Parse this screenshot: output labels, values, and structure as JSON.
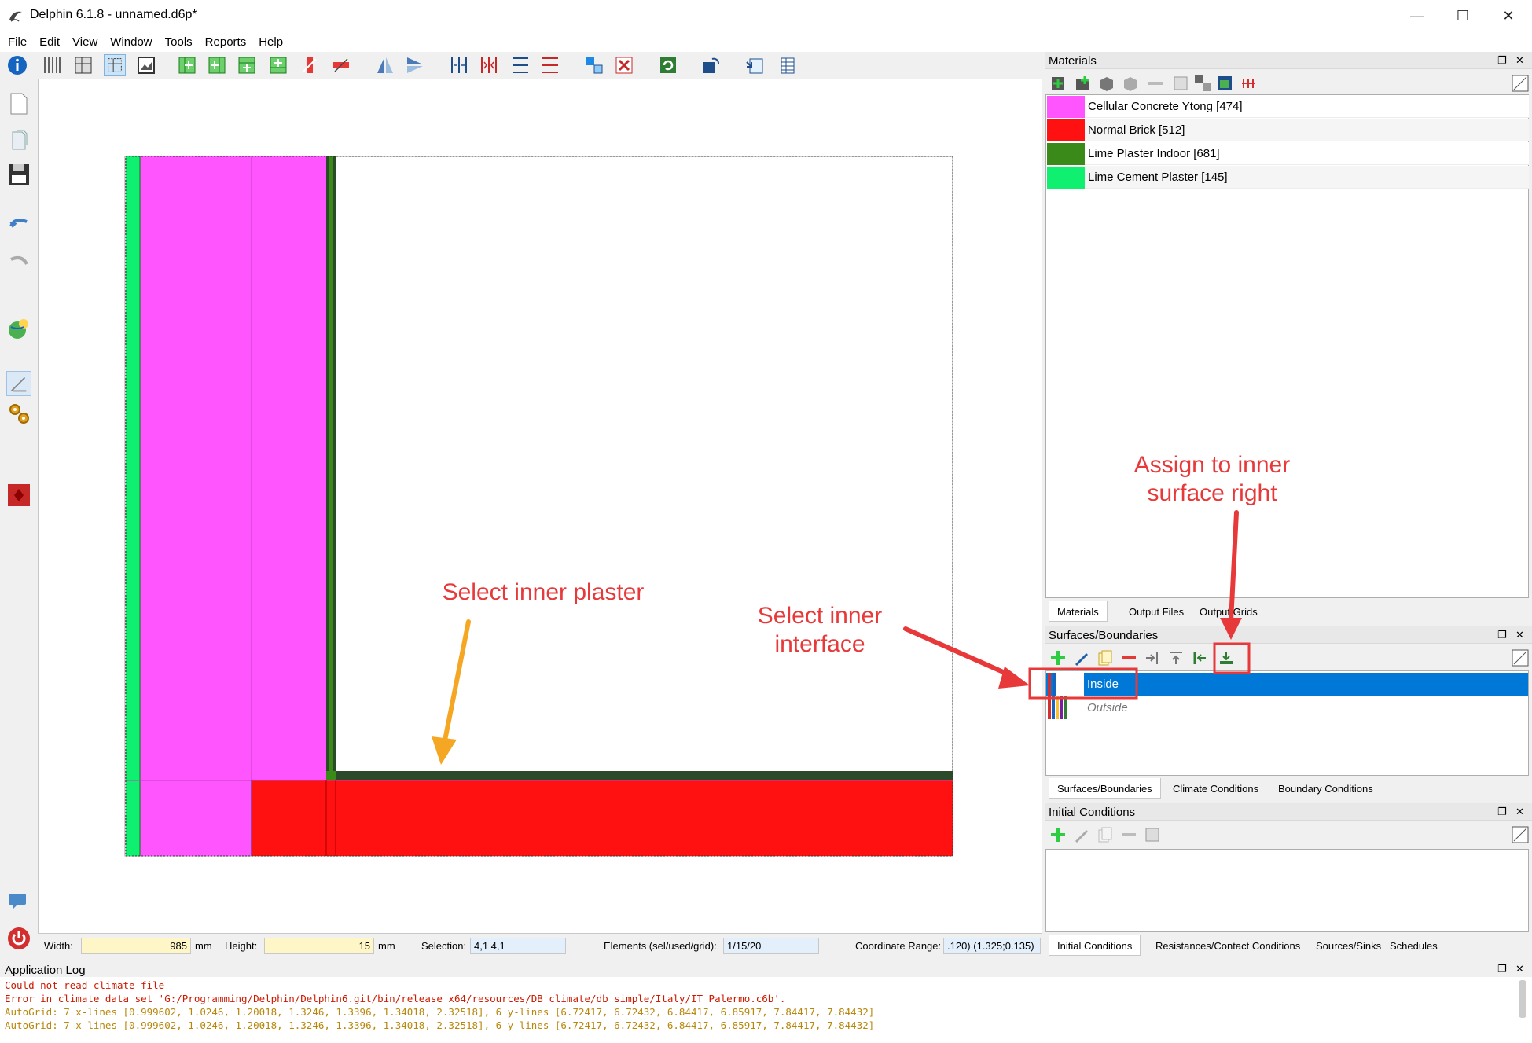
{
  "window": {
    "title": "Delphin 6.1.8 - unnamed.d6p*",
    "minimize": "—",
    "maximize": "☐",
    "close": "✕"
  },
  "menu": [
    "File",
    "Edit",
    "View",
    "Window",
    "Tools",
    "Reports",
    "Help"
  ],
  "status": {
    "width_label": "Width:",
    "width_value": "985",
    "width_unit": "mm",
    "height_label": "Height:",
    "height_value": "15",
    "height_unit": "mm",
    "selection_label": "Selection:",
    "selection_value": "4,1  4,1",
    "elements_label": "Elements (sel/used/grid):",
    "elements_value": "1/15/20",
    "coord_label": "Coordinate Range:",
    "coord_value": ".120)  (1.325;0.135)"
  },
  "materials_panel": {
    "title": "Materials",
    "items": [
      {
        "name": "Cellular Concrete Ytong [474]",
        "color": "#ff55ff"
      },
      {
        "name": "Normal Brick [512]",
        "color": "#ff1111"
      },
      {
        "name": "Lime Plaster Indoor [681]",
        "color": "#3a8a1a"
      },
      {
        "name": "Lime Cement Plaster [145]",
        "color": "#10f070"
      }
    ],
    "tabs": [
      "Materials",
      "Output Files",
      "Output Grids"
    ]
  },
  "surfaces_panel": {
    "title": "Surfaces/Boundaries",
    "items": [
      {
        "name": "Inside",
        "selected": true
      },
      {
        "name": "Outside",
        "selected": false
      }
    ],
    "tabs": [
      "Surfaces/Boundaries",
      "Climate Conditions",
      "Boundary Conditions"
    ]
  },
  "initial_panel": {
    "title": "Initial Conditions",
    "tabs": [
      "Initial Conditions",
      "Resistances/Contact Conditions",
      "Sources/Sinks",
      "Schedules"
    ]
  },
  "log": {
    "title": "Application Log",
    "lines": [
      {
        "type": "err",
        "text": "Could not read climate file"
      },
      {
        "type": "err",
        "text": "Error in climate data set 'G:/Programming/Delphin/Delphin6.git/bin/release_x64/resources/DB_climate/db_simple/Italy/IT_Palermo.c6b'."
      },
      {
        "type": "warn",
        "text": "AutoGrid: 7 x-lines [0.999602, 1.0246, 1.20018, 1.3246, 1.3396, 1.34018, 2.32518], 6 y-lines [6.72417, 6.72432, 6.84417, 6.85917, 7.84417, 7.84432]"
      },
      {
        "type": "warn",
        "text": "AutoGrid: 7 x-lines [0.999602, 1.0246, 1.20018, 1.3246, 1.3396, 1.34018, 2.32518], 6 y-lines [6.72417, 6.72432, 6.84417, 6.85917, 7.84417, 7.84432]"
      }
    ]
  },
  "annotations": {
    "select_plaster": "Select inner plaster",
    "select_interface": "Select inner\ninterface",
    "assign_surface": "Assign to inner\nsurface right",
    "color": "#e8393a",
    "arrow_orange": "#f5a623"
  }
}
